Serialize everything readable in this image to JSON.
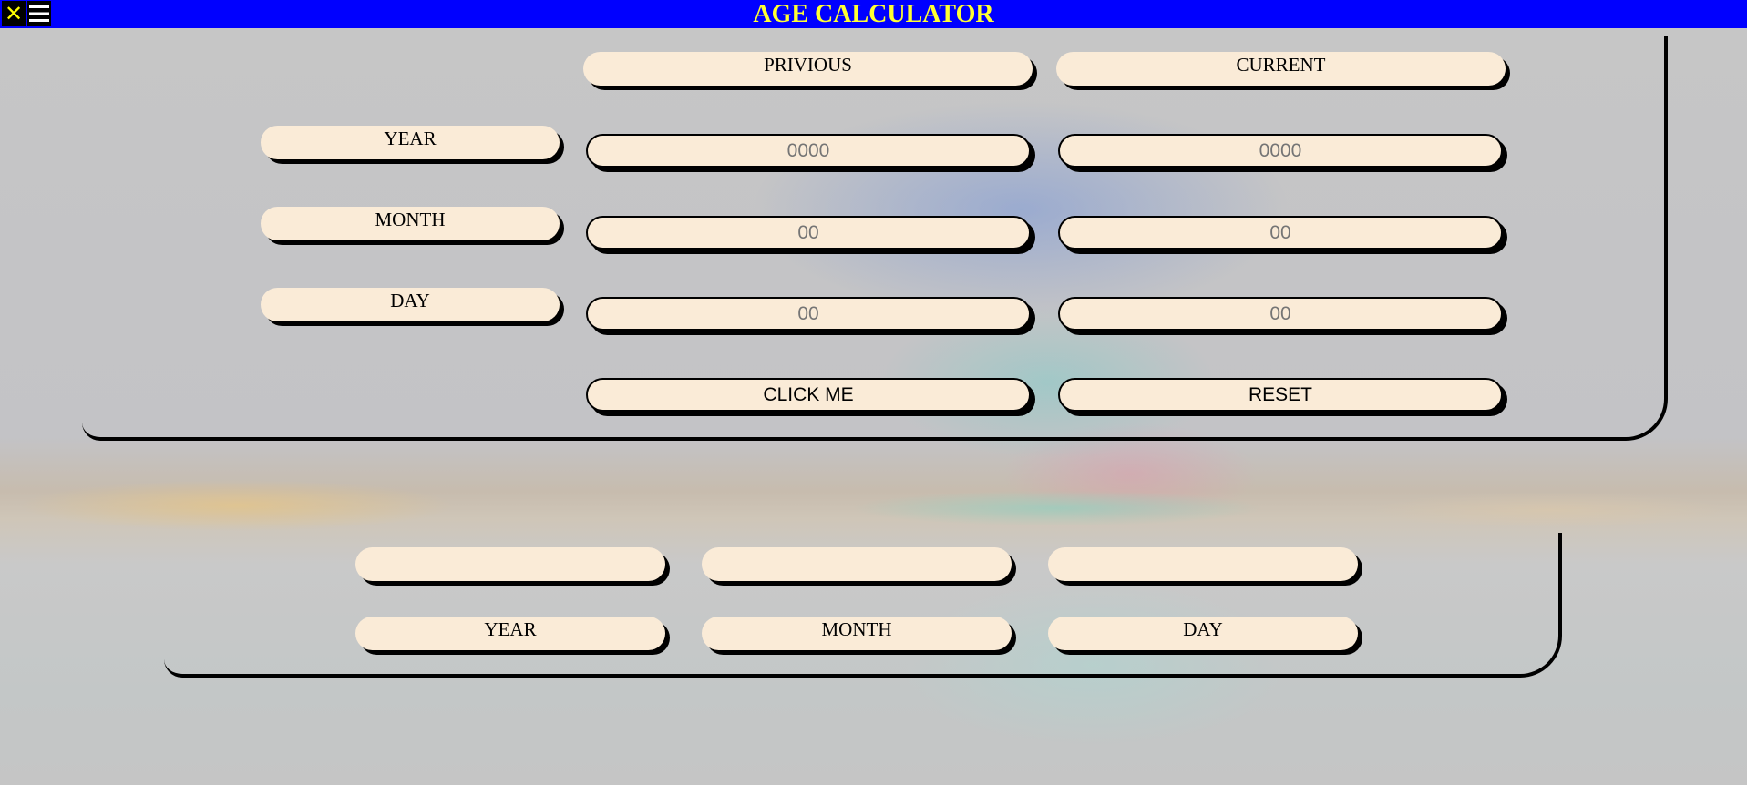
{
  "app": {
    "title": "AGE CALCULATOR"
  },
  "toolbar": {
    "close_glyph": "✕",
    "menu_icon": "hamburger-menu"
  },
  "columns": {
    "previous": "PRIVIOUS",
    "current": "CURRENT"
  },
  "rows": {
    "year": "YEAR",
    "month": "MONTH",
    "day": "DAY"
  },
  "inputs": {
    "prev_year": {
      "value": "",
      "placeholder": "0000"
    },
    "curr_year": {
      "value": "",
      "placeholder": "0000"
    },
    "prev_month": {
      "value": "",
      "placeholder": "00"
    },
    "curr_month": {
      "value": "",
      "placeholder": "00"
    },
    "prev_day": {
      "value": "",
      "placeholder": "00"
    },
    "curr_day": {
      "value": "",
      "placeholder": "00"
    }
  },
  "actions": {
    "calculate": "CLICK ME",
    "reset": "RESET"
  },
  "results": {
    "year_value": "",
    "month_value": "",
    "day_value": "",
    "year_label": "YEAR",
    "month_label": "MONTH",
    "day_label": "DAY"
  },
  "colors": {
    "header_bg": "#0000ff",
    "title": "#ffff33",
    "pill_bg": "#faebd7"
  }
}
